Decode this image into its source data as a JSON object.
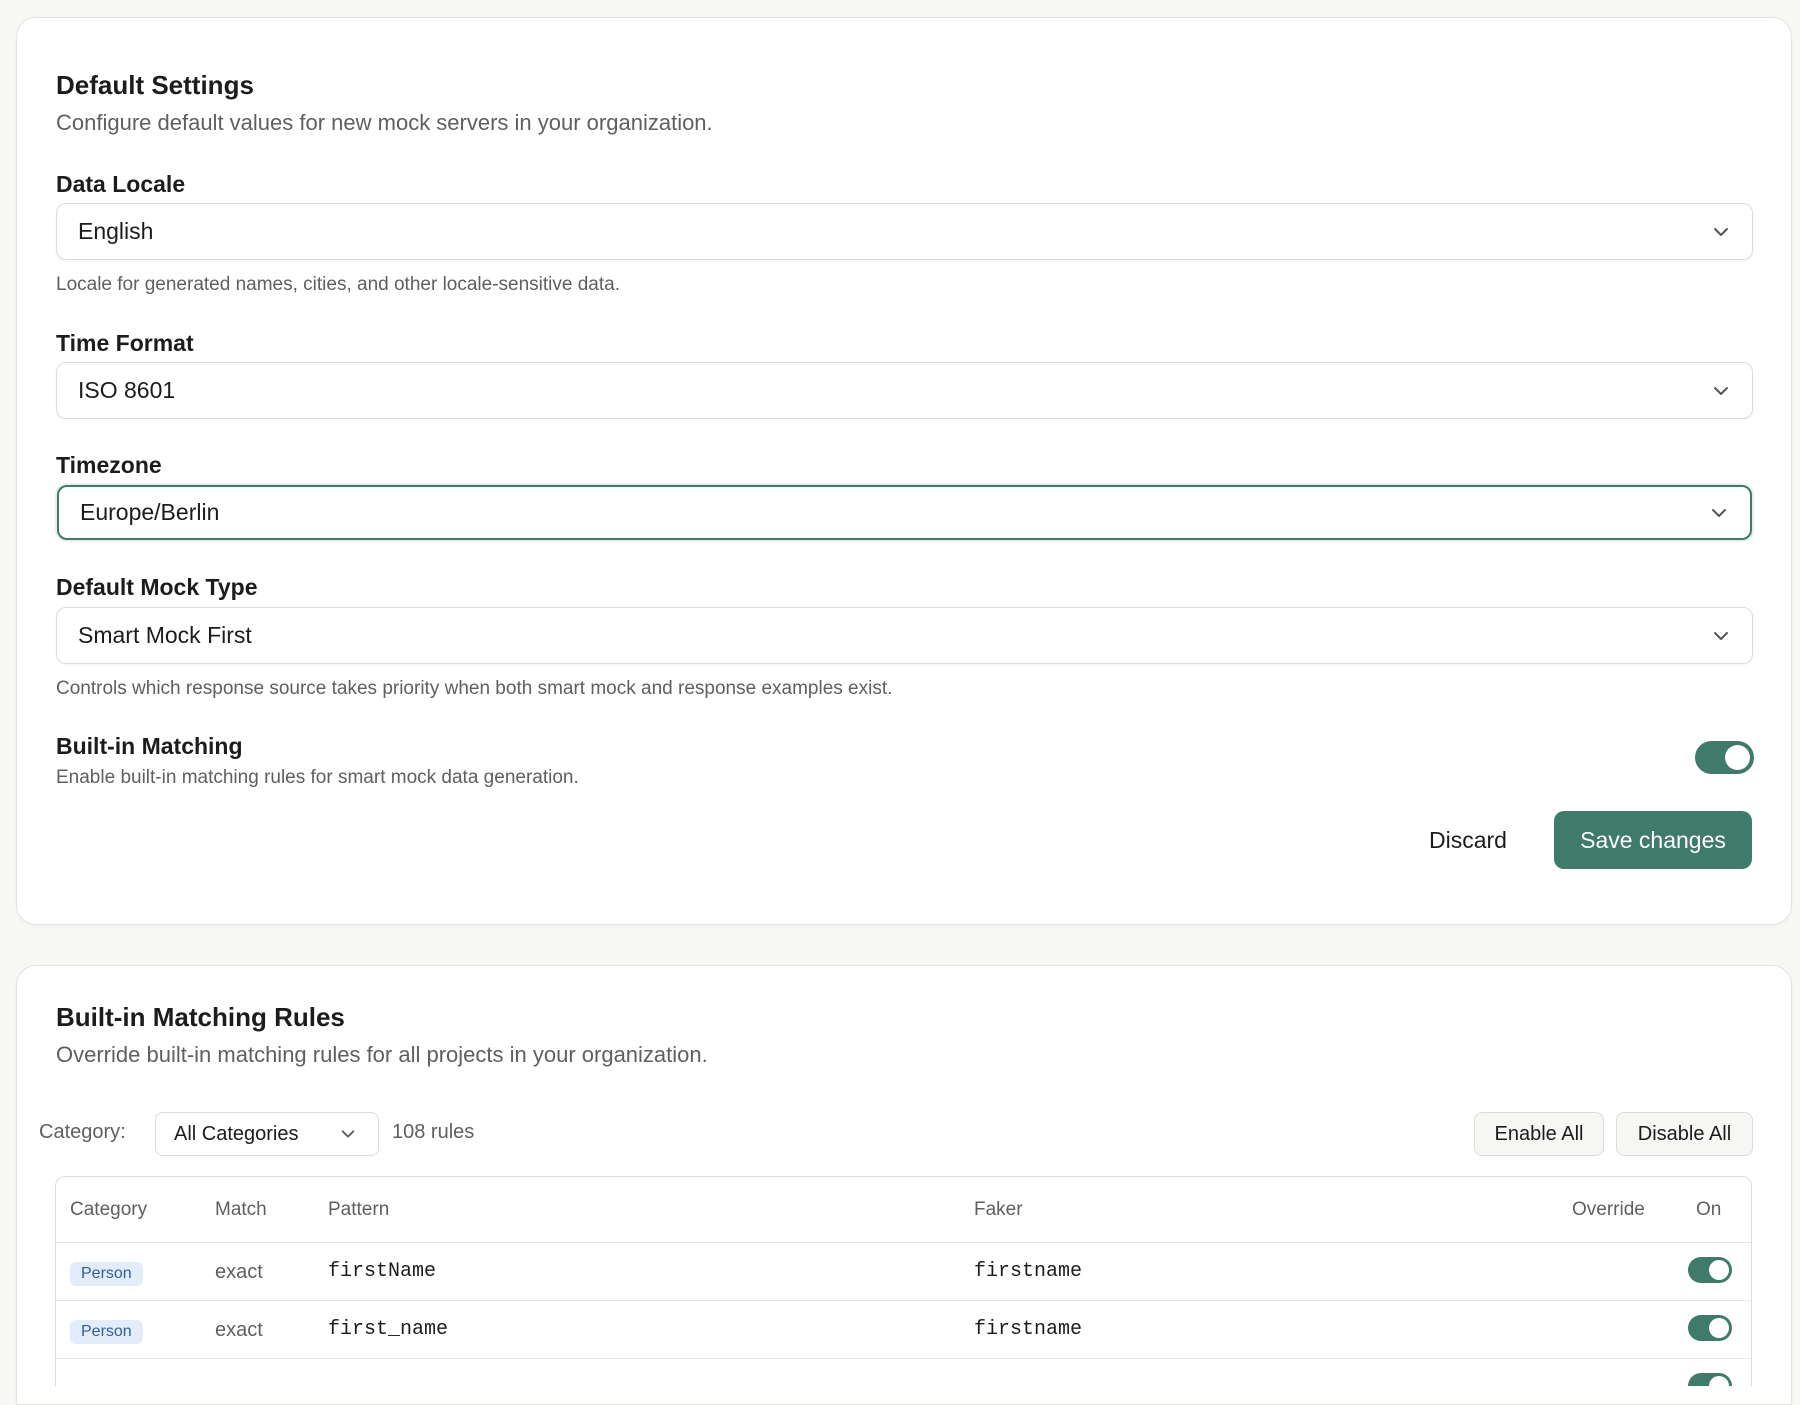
{
  "settings": {
    "title": "Default Settings",
    "subtitle": "Configure default values for new mock servers in your organization.",
    "data_locale": {
      "label": "Data Locale",
      "value": "English",
      "help": "Locale for generated names, cities, and other locale-sensitive data."
    },
    "time_format": {
      "label": "Time Format",
      "value": "ISO 8601"
    },
    "timezone": {
      "label": "Timezone",
      "value": "Europe/Berlin"
    },
    "mock_type": {
      "label": "Default Mock Type",
      "value": "Smart Mock First",
      "help": "Controls which response source takes priority when both smart mock and response examples exist."
    },
    "builtin_matching": {
      "label": "Built-in Matching",
      "help": "Enable built-in matching rules for smart mock data generation.",
      "enabled": true
    },
    "discard_label": "Discard",
    "save_label": "Save changes"
  },
  "rules": {
    "title": "Built-in Matching Rules",
    "subtitle": "Override built-in matching rules for all projects in your organization.",
    "category_label": "Category:",
    "category_value": "All Categories",
    "count": "108 rules",
    "enable_all": "Enable All",
    "disable_all": "Disable All",
    "columns": {
      "category": "Category",
      "match": "Match",
      "pattern": "Pattern",
      "faker": "Faker",
      "override": "Override",
      "on": "On"
    },
    "rows": [
      {
        "category": "Person",
        "match": "exact",
        "pattern": "firstName",
        "faker": "firstname",
        "on": true
      },
      {
        "category": "Person",
        "match": "exact",
        "pattern": "first_name",
        "faker": "firstname",
        "on": true
      }
    ]
  },
  "colors": {
    "accent": "#3f7a6b",
    "badge_bg": "#e3edf9",
    "badge_text": "#2d5f9a"
  }
}
